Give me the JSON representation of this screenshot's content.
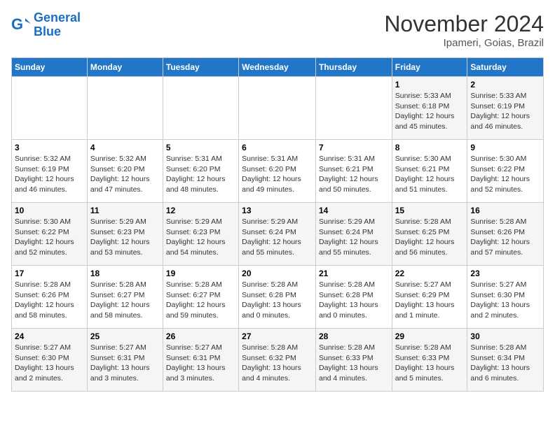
{
  "logo": {
    "line1": "General",
    "line2": "Blue"
  },
  "title": "November 2024",
  "location": "Ipameri, Goias, Brazil",
  "weekdays": [
    "Sunday",
    "Monday",
    "Tuesday",
    "Wednesday",
    "Thursday",
    "Friday",
    "Saturday"
  ],
  "weeks": [
    [
      {
        "day": "",
        "info": ""
      },
      {
        "day": "",
        "info": ""
      },
      {
        "day": "",
        "info": ""
      },
      {
        "day": "",
        "info": ""
      },
      {
        "day": "",
        "info": ""
      },
      {
        "day": "1",
        "info": "Sunrise: 5:33 AM\nSunset: 6:18 PM\nDaylight: 12 hours and 45 minutes."
      },
      {
        "day": "2",
        "info": "Sunrise: 5:33 AM\nSunset: 6:19 PM\nDaylight: 12 hours and 46 minutes."
      }
    ],
    [
      {
        "day": "3",
        "info": "Sunrise: 5:32 AM\nSunset: 6:19 PM\nDaylight: 12 hours and 46 minutes."
      },
      {
        "day": "4",
        "info": "Sunrise: 5:32 AM\nSunset: 6:20 PM\nDaylight: 12 hours and 47 minutes."
      },
      {
        "day": "5",
        "info": "Sunrise: 5:31 AM\nSunset: 6:20 PM\nDaylight: 12 hours and 48 minutes."
      },
      {
        "day": "6",
        "info": "Sunrise: 5:31 AM\nSunset: 6:20 PM\nDaylight: 12 hours and 49 minutes."
      },
      {
        "day": "7",
        "info": "Sunrise: 5:31 AM\nSunset: 6:21 PM\nDaylight: 12 hours and 50 minutes."
      },
      {
        "day": "8",
        "info": "Sunrise: 5:30 AM\nSunset: 6:21 PM\nDaylight: 12 hours and 51 minutes."
      },
      {
        "day": "9",
        "info": "Sunrise: 5:30 AM\nSunset: 6:22 PM\nDaylight: 12 hours and 52 minutes."
      }
    ],
    [
      {
        "day": "10",
        "info": "Sunrise: 5:30 AM\nSunset: 6:22 PM\nDaylight: 12 hours and 52 minutes."
      },
      {
        "day": "11",
        "info": "Sunrise: 5:29 AM\nSunset: 6:23 PM\nDaylight: 12 hours and 53 minutes."
      },
      {
        "day": "12",
        "info": "Sunrise: 5:29 AM\nSunset: 6:23 PM\nDaylight: 12 hours and 54 minutes."
      },
      {
        "day": "13",
        "info": "Sunrise: 5:29 AM\nSunset: 6:24 PM\nDaylight: 12 hours and 55 minutes."
      },
      {
        "day": "14",
        "info": "Sunrise: 5:29 AM\nSunset: 6:24 PM\nDaylight: 12 hours and 55 minutes."
      },
      {
        "day": "15",
        "info": "Sunrise: 5:28 AM\nSunset: 6:25 PM\nDaylight: 12 hours and 56 minutes."
      },
      {
        "day": "16",
        "info": "Sunrise: 5:28 AM\nSunset: 6:26 PM\nDaylight: 12 hours and 57 minutes."
      }
    ],
    [
      {
        "day": "17",
        "info": "Sunrise: 5:28 AM\nSunset: 6:26 PM\nDaylight: 12 hours and 58 minutes."
      },
      {
        "day": "18",
        "info": "Sunrise: 5:28 AM\nSunset: 6:27 PM\nDaylight: 12 hours and 58 minutes."
      },
      {
        "day": "19",
        "info": "Sunrise: 5:28 AM\nSunset: 6:27 PM\nDaylight: 12 hours and 59 minutes."
      },
      {
        "day": "20",
        "info": "Sunrise: 5:28 AM\nSunset: 6:28 PM\nDaylight: 13 hours and 0 minutes."
      },
      {
        "day": "21",
        "info": "Sunrise: 5:28 AM\nSunset: 6:28 PM\nDaylight: 13 hours and 0 minutes."
      },
      {
        "day": "22",
        "info": "Sunrise: 5:27 AM\nSunset: 6:29 PM\nDaylight: 13 hours and 1 minute."
      },
      {
        "day": "23",
        "info": "Sunrise: 5:27 AM\nSunset: 6:30 PM\nDaylight: 13 hours and 2 minutes."
      }
    ],
    [
      {
        "day": "24",
        "info": "Sunrise: 5:27 AM\nSunset: 6:30 PM\nDaylight: 13 hours and 2 minutes."
      },
      {
        "day": "25",
        "info": "Sunrise: 5:27 AM\nSunset: 6:31 PM\nDaylight: 13 hours and 3 minutes."
      },
      {
        "day": "26",
        "info": "Sunrise: 5:27 AM\nSunset: 6:31 PM\nDaylight: 13 hours and 3 minutes."
      },
      {
        "day": "27",
        "info": "Sunrise: 5:28 AM\nSunset: 6:32 PM\nDaylight: 13 hours and 4 minutes."
      },
      {
        "day": "28",
        "info": "Sunrise: 5:28 AM\nSunset: 6:33 PM\nDaylight: 13 hours and 4 minutes."
      },
      {
        "day": "29",
        "info": "Sunrise: 5:28 AM\nSunset: 6:33 PM\nDaylight: 13 hours and 5 minutes."
      },
      {
        "day": "30",
        "info": "Sunrise: 5:28 AM\nSunset: 6:34 PM\nDaylight: 13 hours and 6 minutes."
      }
    ]
  ]
}
